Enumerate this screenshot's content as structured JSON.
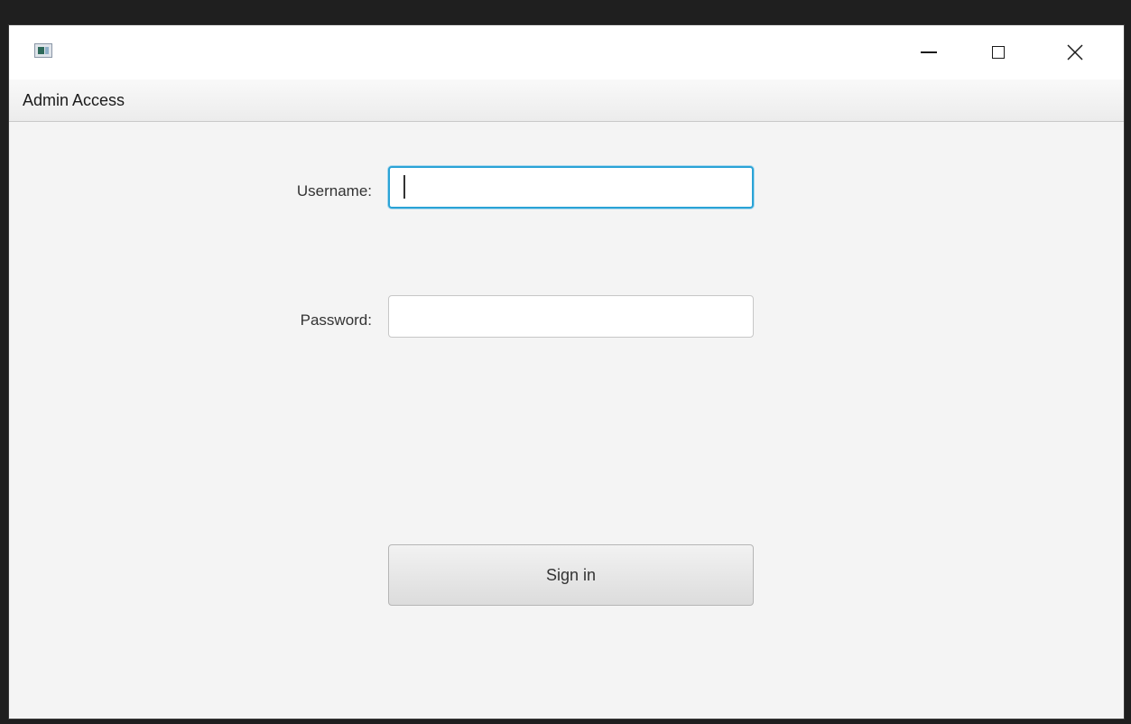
{
  "window": {
    "title": "",
    "controls": [
      "minimize-icon",
      "maximize-icon",
      "close-icon"
    ]
  },
  "menubar": {
    "items": [
      {
        "label": "Admin Access"
      }
    ]
  },
  "form": {
    "username_label": "Username:",
    "username_value": "",
    "password_label": "Password:",
    "password_value": "",
    "signin_label": "Sign in"
  },
  "colors": {
    "focus_ring": "#2aa3d6",
    "background": "#f4f4f4"
  }
}
